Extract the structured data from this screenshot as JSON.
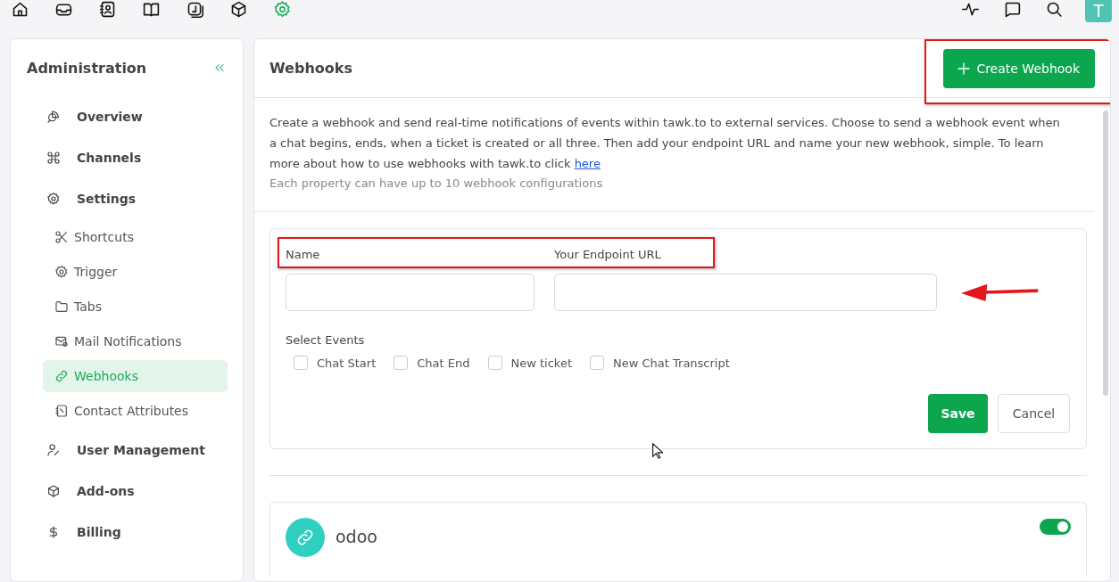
{
  "top_nav": {
    "items": [
      {
        "selected": false
      },
      {
        "selected": false
      },
      {
        "selected": false
      },
      {
        "selected": false
      },
      {
        "selected": false
      },
      {
        "selected": false
      },
      {
        "selected": true
      }
    ],
    "avatar": "T"
  },
  "sidebar": {
    "title": "Administration",
    "items": [
      {
        "label": "Overview",
        "selected": false
      },
      {
        "label": "Channels",
        "selected": false
      },
      {
        "label": "Settings",
        "selected": false,
        "children": [
          {
            "label": "Shortcuts",
            "selected": false
          },
          {
            "label": "Trigger",
            "selected": false
          },
          {
            "label": "Tabs",
            "selected": false
          },
          {
            "label": "Mail Notifications",
            "selected": false
          },
          {
            "label": "Webhooks",
            "selected": true
          },
          {
            "label": "Contact Attributes",
            "selected": false
          }
        ]
      },
      {
        "label": "User Management",
        "selected": false
      },
      {
        "label": "Add-ons",
        "selected": false
      },
      {
        "label": "Billing",
        "selected": false
      }
    ]
  },
  "page": {
    "title": "Webhooks",
    "create_button": "Create Webhook",
    "description": "Create a webhook and send real-time notifications of events within tawk.to to external services. Choose to send a webhook event when a chat begins, ends, when a ticket is created or all three. Then add your endpoint URL and name your new webhook, simple. To learn more about how to use webhooks with tawk.to click",
    "link": "here",
    "note": "Each property can have up to 10 webhook configurations",
    "form": {
      "fields": [
        {
          "label": "Name"
        },
        {
          "label": "Your Endpoint URL"
        }
      ],
      "events_label": "Select Events",
      "events": [
        {
          "label": "Chat Start",
          "checked": false
        },
        {
          "label": "Chat End",
          "checked": false
        },
        {
          "label": "New ticket",
          "checked": false
        },
        {
          "label": "New Chat Transcript",
          "checked": false
        }
      ],
      "save": "Save",
      "cancel": "Cancel"
    },
    "webhooks": [
      {
        "name": "odoo",
        "on": true
      }
    ]
  }
}
